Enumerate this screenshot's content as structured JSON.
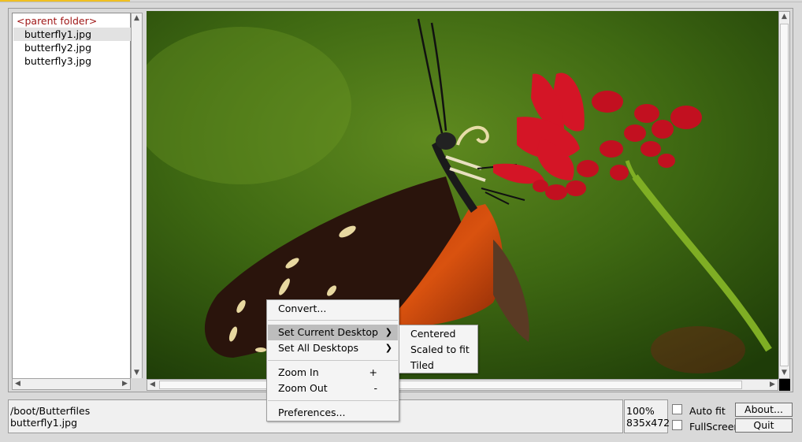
{
  "file_list": {
    "items": [
      {
        "label": "<parent folder>",
        "kind": "parent"
      },
      {
        "label": "butterfly1.jpg",
        "kind": "file",
        "selected": true
      },
      {
        "label": "butterfly2.jpg",
        "kind": "file"
      },
      {
        "label": "butterfly3.jpg",
        "kind": "file"
      }
    ]
  },
  "icons": {
    "scroll_up": "▲",
    "scroll_down": "▼",
    "scroll_left": "◀",
    "scroll_right": "▶",
    "submenu": "❯"
  },
  "status": {
    "path": "/boot/Butterfiles",
    "filename": "butterfly1.jpg",
    "zoom": "100%",
    "dimensions": "835x472"
  },
  "options": {
    "auto_fit_label": "Auto fit",
    "auto_fit_checked": false,
    "fullscreen_label": "FullScreen",
    "fullscreen_checked": false
  },
  "buttons": {
    "about": "About...",
    "quit": "Quit"
  },
  "context_menu": {
    "convert": "Convert...",
    "set_current_desktop": "Set Current Desktop",
    "set_all_desktops": "Set All Desktops",
    "zoom_in": "Zoom In",
    "zoom_in_accel": "+",
    "zoom_out": "Zoom Out",
    "zoom_out_accel": "-",
    "preferences": "Preferences..."
  },
  "submenu": {
    "centered": "Centered",
    "scaled_to_fit": "Scaled to fit",
    "tiled": "Tiled"
  },
  "colors": {
    "parent_folder_text": "#a01818",
    "selected_row": "#e2e2e2",
    "menu_highlight": "#bdbdbd"
  }
}
